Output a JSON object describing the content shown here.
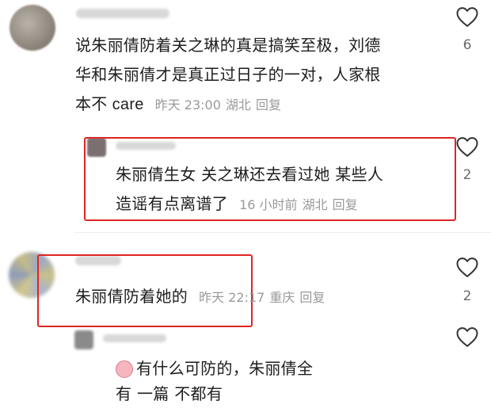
{
  "comments": [
    {
      "text_lines": [
        "说朱丽倩防着关之琳的真是搞笑至极，刘德",
        "华和朱丽倩才是真正过日子的一对，人家根",
        "本不"
      ],
      "inline_tail": "care",
      "time": "昨天 23:00",
      "location": "湖北",
      "reply_label": "回复",
      "likes": "6"
    },
    {
      "text_lines": [
        "朱丽倩生女 关之琳还去看过她 某些人",
        "造谣有点离谱了"
      ],
      "time": "16 小时前",
      "location": "湖北",
      "reply_label": "回复",
      "likes": "2"
    },
    {
      "text_lines": [
        "朱丽倩防着她的"
      ],
      "time": "昨天 22:17",
      "location": "重庆",
      "reply_label": "回复",
      "likes": "2"
    },
    {
      "text_lines": [
        "有什么可防的，朱丽倩全"
      ],
      "partial_line": "有 一篇 不都有 ",
      "time": "",
      "location": "",
      "reply_label": ""
    }
  ],
  "colors": {
    "highlight_box": "#e02424",
    "meta_text": "#9a9a9a",
    "body_text": "#1e1e1e"
  },
  "icons": [
    "heart-outline-icon",
    "face-emoji-icon"
  ]
}
